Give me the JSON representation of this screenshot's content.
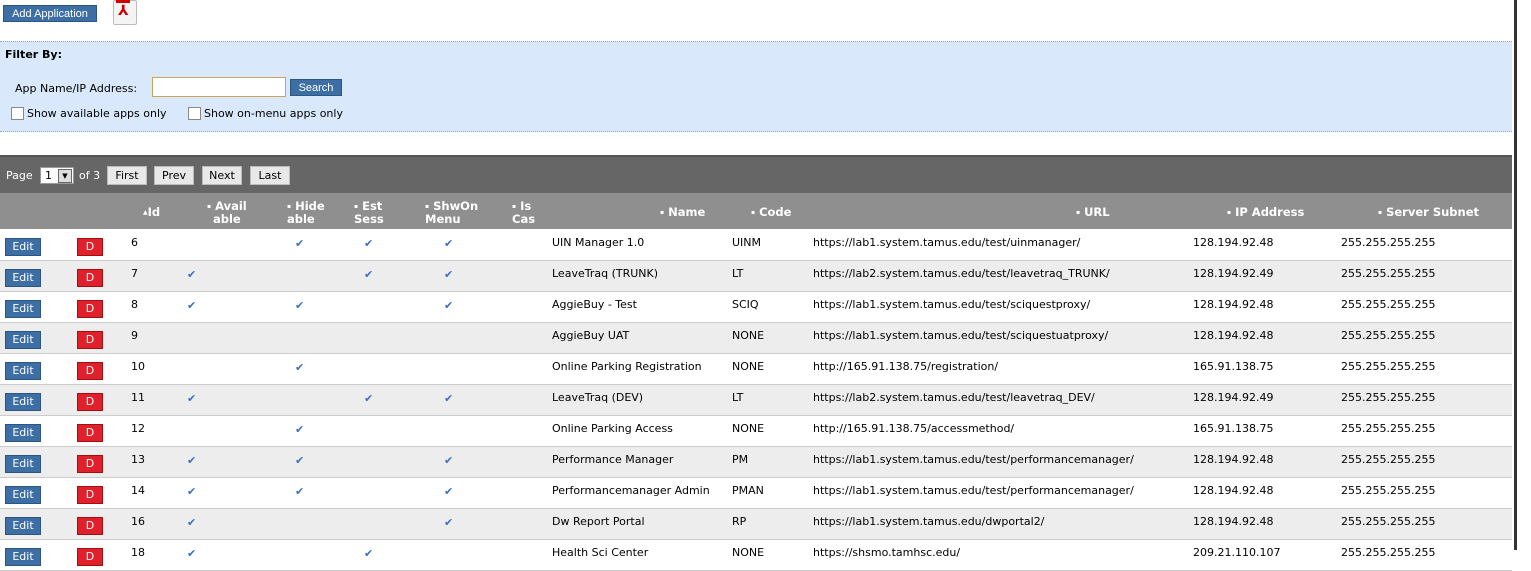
{
  "toolbar": {
    "add_label": "Add Application",
    "pdf_icon": "pdf-icon"
  },
  "filter": {
    "title": "Filter By:",
    "search_label": "App Name/IP Address:",
    "search_value": "",
    "search_button": "Search",
    "cb_available": "Show available apps only",
    "cb_onmenu": "Show on-menu apps only"
  },
  "pager": {
    "page_label": "Page",
    "current": "1",
    "of_label": "of 3",
    "first": "First",
    "prev": "Prev",
    "next": "Next",
    "last": "Last"
  },
  "columns": {
    "id": "Id",
    "avail1": "Avail",
    "avail2": "able",
    "hide1": "Hide",
    "hide2": "able",
    "est1": "Est",
    "est2": "Sess",
    "shw1": "ShwOn",
    "shw2": "Menu",
    "is1": "Is",
    "is2": "Cas",
    "name": "Name",
    "code": "Code",
    "url": "URL",
    "ip": "IP Address",
    "subnet": "Server Subnet"
  },
  "row_buttons": {
    "edit": "Edit",
    "delete": "D"
  },
  "rows": [
    {
      "id": "6",
      "avail": false,
      "hide": true,
      "est": true,
      "shw": true,
      "name": "UIN Manager 1.0",
      "code": "UINM",
      "url": "https://lab1.system.tamus.edu/test/uinmanager/",
      "ip": "128.194.92.48",
      "subnet": "255.255.255.255"
    },
    {
      "id": "7",
      "avail": true,
      "hide": false,
      "est": true,
      "shw": true,
      "name": "LeaveTraq (TRUNK)",
      "code": "LT",
      "url": "https://lab2.system.tamus.edu/test/leavetraq_TRUNK/",
      "ip": "128.194.92.49",
      "subnet": "255.255.255.255"
    },
    {
      "id": "8",
      "avail": true,
      "hide": true,
      "est": false,
      "shw": true,
      "name": "AggieBuy - Test",
      "code": "SCIQ",
      "url": "https://lab1.system.tamus.edu/test/sciquestproxy/",
      "ip": "128.194.92.48",
      "subnet": "255.255.255.255"
    },
    {
      "id": "9",
      "avail": false,
      "hide": false,
      "est": false,
      "shw": false,
      "name": "AggieBuy UAT",
      "code": "NONE",
      "url": "https://lab1.system.tamus.edu/test/sciquestuatproxy/",
      "ip": "128.194.92.48",
      "subnet": "255.255.255.255"
    },
    {
      "id": "10",
      "avail": false,
      "hide": true,
      "est": false,
      "shw": false,
      "name": "Online Parking Registration",
      "code": "NONE",
      "url": "http://165.91.138.75/registration/",
      "ip": "165.91.138.75",
      "subnet": "255.255.255.255"
    },
    {
      "id": "11",
      "avail": true,
      "hide": false,
      "est": true,
      "shw": true,
      "name": "LeaveTraq (DEV)",
      "code": "LT",
      "url": "https://lab2.system.tamus.edu/test/leavetraq_DEV/",
      "ip": "128.194.92.49",
      "subnet": "255.255.255.255"
    },
    {
      "id": "12",
      "avail": false,
      "hide": true,
      "est": false,
      "shw": false,
      "name": "Online Parking Access",
      "code": "NONE",
      "url": "http://165.91.138.75/accessmethod/",
      "ip": "165.91.138.75",
      "subnet": "255.255.255.255"
    },
    {
      "id": "13",
      "avail": true,
      "hide": true,
      "est": false,
      "shw": true,
      "name": "Performance Manager",
      "code": "PM",
      "url": "https://lab1.system.tamus.edu/test/performancemanager/",
      "ip": "128.194.92.48",
      "subnet": "255.255.255.255"
    },
    {
      "id": "14",
      "avail": true,
      "hide": true,
      "est": false,
      "shw": true,
      "name": "Performancemanager Admin",
      "code": "PMAN",
      "url": "https://lab1.system.tamus.edu/test/performancemanager/",
      "ip": "128.194.92.48",
      "subnet": "255.255.255.255"
    },
    {
      "id": "16",
      "avail": true,
      "hide": false,
      "est": false,
      "shw": true,
      "name": "Dw Report Portal",
      "code": "RP",
      "url": "https://lab1.system.tamus.edu/dwportal2/",
      "ip": "128.194.92.48",
      "subnet": "255.255.255.255"
    },
    {
      "id": "18",
      "avail": true,
      "hide": false,
      "est": true,
      "shw": false,
      "name": "Health Sci Center",
      "code": "NONE",
      "url": "https://shsmo.tamhsc.edu/",
      "ip": "209.21.110.107",
      "subnet": "255.255.255.255"
    }
  ]
}
